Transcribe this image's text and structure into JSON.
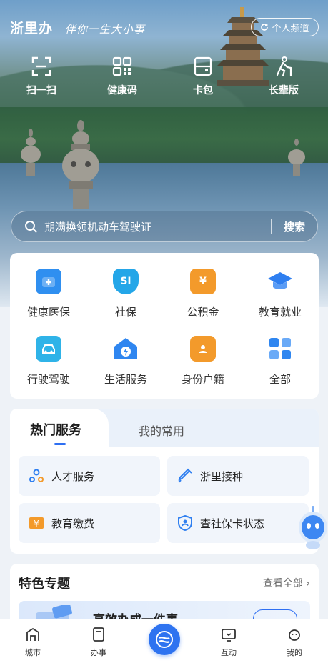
{
  "header": {
    "app_name": "浙里办",
    "slogan": "伴你一生大小事",
    "channel_label": "个人频道",
    "channel_icon": "refresh-icon"
  },
  "quick_actions": [
    {
      "label": "扫一扫",
      "icon": "scan-icon"
    },
    {
      "label": "健康码",
      "icon": "qr-code-icon"
    },
    {
      "label": "卡包",
      "icon": "card-wallet-icon"
    },
    {
      "label": "长辈版",
      "icon": "elder-icon"
    }
  ],
  "search": {
    "placeholder": "期满换领机动车驾驶证",
    "button_label": "搜索"
  },
  "services": [
    {
      "label": "健康医保",
      "icon": "medical-kit-icon",
      "color": "#2f8ff0"
    },
    {
      "label": "社保",
      "icon": "shield-si-icon",
      "color": "#24a6e8"
    },
    {
      "label": "公积金",
      "icon": "house-yuan-icon",
      "color": "#f39a2b"
    },
    {
      "label": "教育就业",
      "icon": "graduation-cap-icon",
      "color": "#2f7ff0"
    },
    {
      "label": "行驶驾驶",
      "icon": "car-icon",
      "color": "#2fb3e8"
    },
    {
      "label": "生活服务",
      "icon": "home-bolt-icon",
      "color": "#2f86f0"
    },
    {
      "label": "身份户籍",
      "icon": "id-card-icon",
      "color": "#f39a2b"
    },
    {
      "label": "全部",
      "icon": "grid-icon",
      "color": "#2f86f0"
    }
  ],
  "hot": {
    "tab_active": "热门服务",
    "tab_other": "我的常用",
    "items": [
      {
        "label": "人才服务",
        "icon": "talent-icon"
      },
      {
        "label": "浙里接种",
        "icon": "vaccine-icon"
      },
      {
        "label": "教育缴费",
        "icon": "education-fee-icon"
      },
      {
        "label": "查社保卡状态",
        "icon": "social-card-icon"
      }
    ]
  },
  "featured": {
    "title": "特色专题",
    "more_label": "查看全部",
    "banner_text": "高效办成一件事"
  },
  "bottom_nav": [
    {
      "label": "城市",
      "icon": "city-icon"
    },
    {
      "label": "办事",
      "icon": "document-icon"
    },
    {
      "label": "",
      "icon": "zheli-logo-icon"
    },
    {
      "label": "互动",
      "icon": "chat-tv-icon"
    },
    {
      "label": "我的",
      "icon": "profile-face-icon"
    }
  ]
}
